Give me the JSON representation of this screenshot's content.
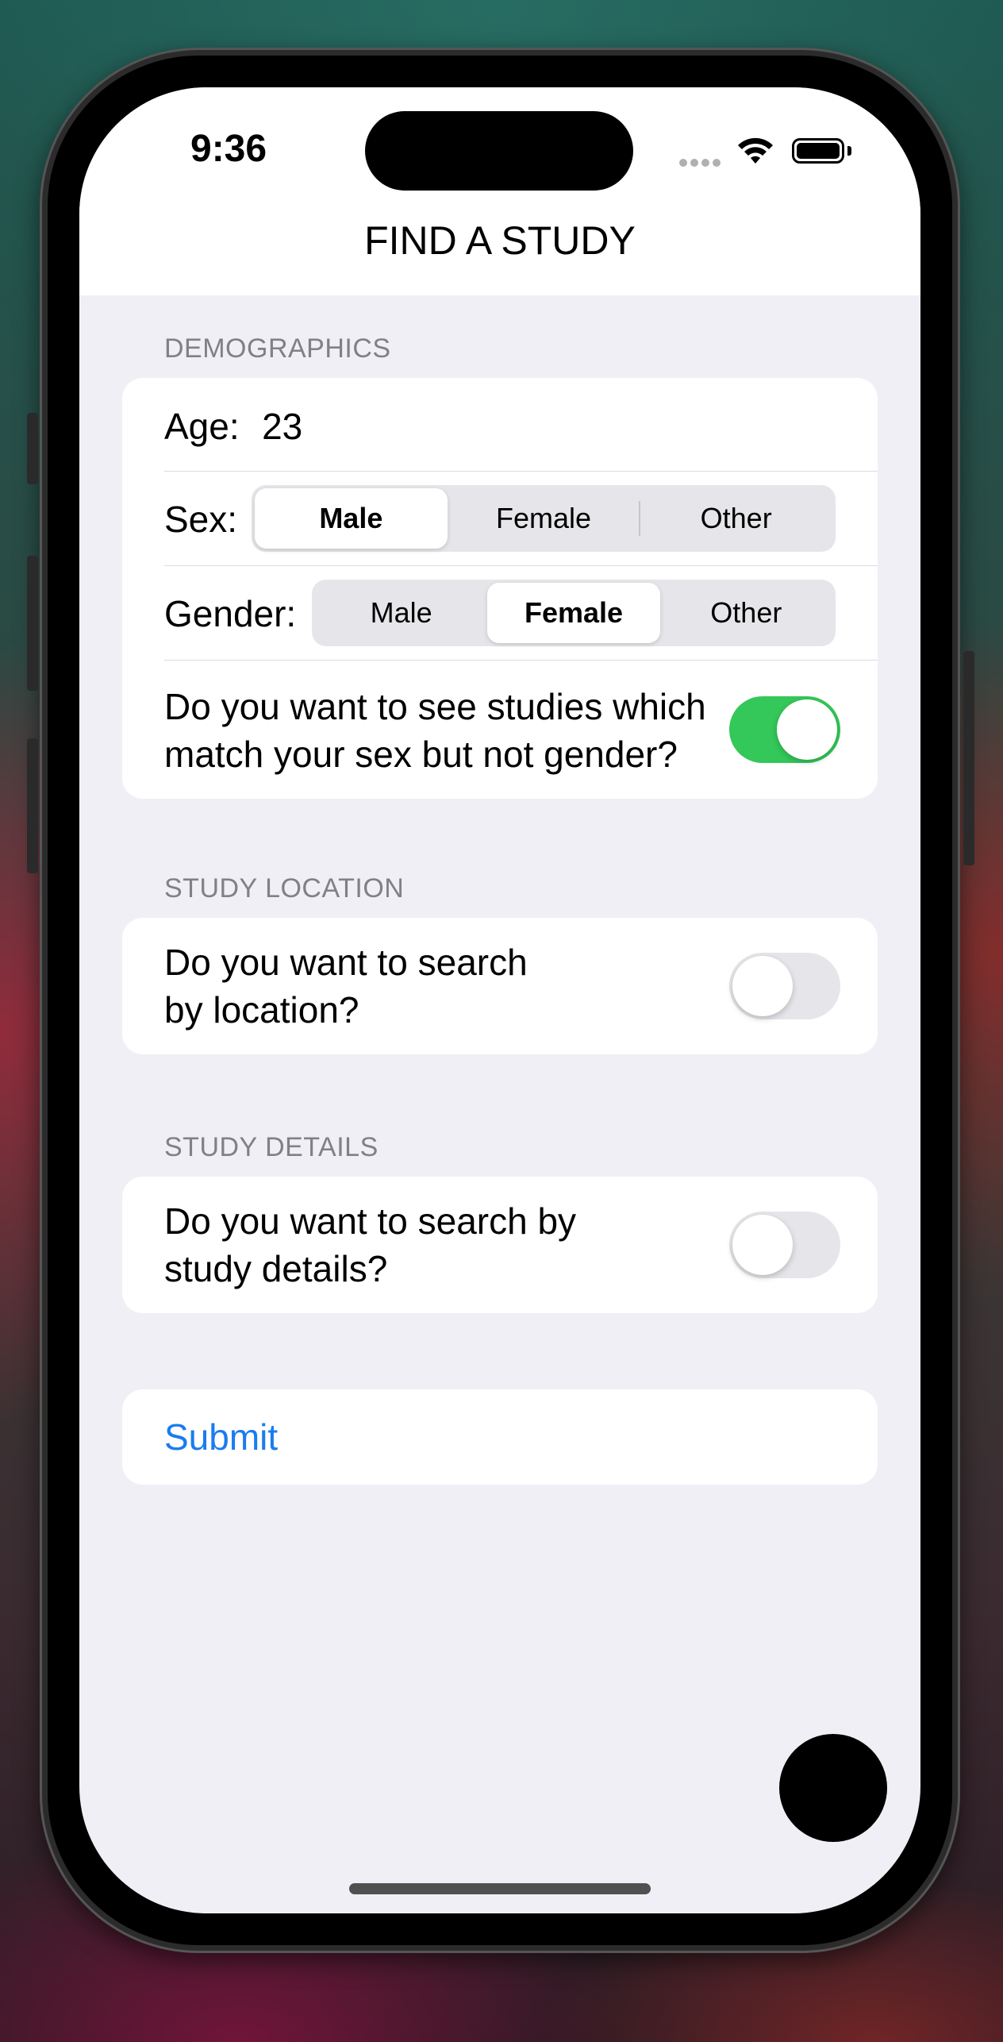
{
  "status_bar": {
    "time": "9:36"
  },
  "header": {
    "title": "FIND A STUDY"
  },
  "demographics": {
    "section_title": "DEMOGRAPHICS",
    "age_label": "Age:",
    "age_value": "23",
    "sex_label": "Sex:",
    "sex_options": [
      "Male",
      "Female",
      "Other"
    ],
    "sex_selected": "Male",
    "gender_label": "Gender:",
    "gender_options": [
      "Male",
      "Female",
      "Other"
    ],
    "gender_selected": "Female",
    "mismatch_question_line1": "Do you want to see studies which",
    "mismatch_question_line2": "match your sex but not gender?",
    "mismatch_toggle": "on"
  },
  "location": {
    "section_title": "STUDY LOCATION",
    "question_line1": "Do you want to search",
    "question_line2": "by location?",
    "toggle": "off"
  },
  "details": {
    "section_title": "STUDY DETAILS",
    "question_line1": "Do you want to search by",
    "question_line2": "study details?",
    "toggle": "off"
  },
  "submit": {
    "label": "Submit"
  },
  "colors": {
    "accent": "#1a7cf0",
    "toggle_on": "#34c759",
    "background": "#f0eff5"
  }
}
